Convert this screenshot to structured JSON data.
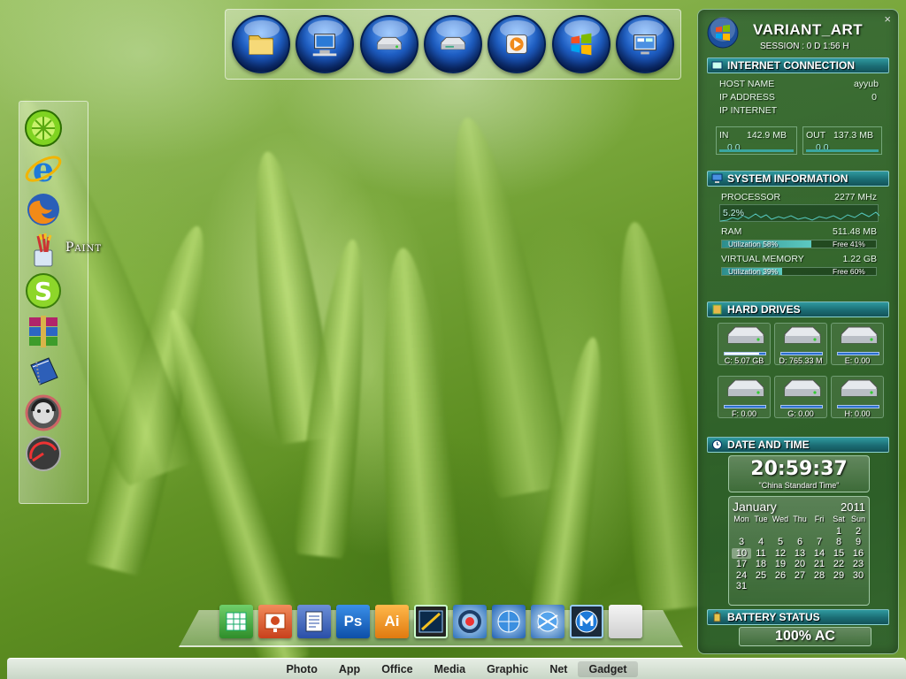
{
  "desktop": {
    "top_dock": {
      "icons": [
        "folder-icon",
        "my-computer-icon",
        "drive-icon",
        "removable-drive-icon",
        "media-player-icon",
        "windows-logo-icon",
        "control-panel-icon"
      ]
    },
    "left_dock": {
      "icons": [
        "limewire-icon",
        "internet-explorer-icon",
        "firefox-icon",
        "paint-icon",
        "skype-icon",
        "winrar-icon",
        "notebook-icon",
        "napster-icon",
        "speedometer-icon"
      ],
      "paint_label": "Paint"
    },
    "bottom_dock": {
      "icons": [
        "excel-icon",
        "powerpoint-icon",
        "word-icon",
        "photoshop-icon",
        "illustrator-icon",
        "graph-window-icon",
        "steam-icon",
        "settings-globe-icon",
        "network-globe-icon",
        "maxthon-icon",
        "blank-doc-icon"
      ],
      "labels": {
        "photoshop": "Ps",
        "illustrator": "Ai"
      }
    }
  },
  "panel": {
    "title": "VARIANT_ART",
    "session": "SESSION : 0 D 1:56 H",
    "close_glyph": "×",
    "internet": {
      "header": "INTERNET CONNECTION",
      "host_label": "HOST NAME",
      "host_value": "ayyub",
      "ip_label": "IP ADDRESS",
      "ip_value": "0",
      "ipi_label": "IP INTERNET",
      "in_label": "IN",
      "in_value": "142.9 MB",
      "in_rate": "0.0",
      "out_label": "OUT",
      "out_value": "137.3 MB",
      "out_rate": "0.0"
    },
    "system": {
      "header": "SYSTEM INFORMATION",
      "processor_label": "PROCESSOR",
      "processor_value": "2277 MHz",
      "cpu_load": "5.2%",
      "ram_label": "RAM",
      "ram_value": "511.48 MB",
      "ram_util": "Utilization 58%",
      "ram_free": "Free 41%",
      "ram_fraction": 0.58,
      "vm_label": "VIRTUAL MEMORY",
      "vm_value": "1.22 GB",
      "vm_util": "Utilization 39%",
      "vm_free": "Free 60%",
      "vm_fraction": 0.39
    },
    "drives": {
      "header": "HARD DRIVES",
      "items": [
        {
          "label": "C: 5.07 GB",
          "fill": 0.85
        },
        {
          "label": "D: 765.33 M",
          "fill": 0.0
        },
        {
          "label": "E: 0.00",
          "fill": 0.0
        },
        {
          "label": "F: 0.00",
          "fill": 0.0
        },
        {
          "label": "G: 0.00",
          "fill": 0.0
        },
        {
          "label": "H: 0.00",
          "fill": 0.0
        }
      ]
    },
    "datetime": {
      "header": "DATE AND TIME",
      "time": "20:59:37",
      "zone": "\"China Standard Time\"",
      "month": "January",
      "year": "2011",
      "weekdays": [
        "Mon",
        "Tue",
        "Wed",
        "Thu",
        "Fri",
        "Sat",
        "Sun"
      ],
      "days": [
        "",
        "",
        "",
        "",
        "",
        "1",
        "2",
        "3",
        "4",
        "5",
        "6",
        "7",
        "8",
        "9",
        "10",
        "11",
        "12",
        "13",
        "14",
        "15",
        "16",
        "17",
        "18",
        "19",
        "20",
        "21",
        "22",
        "23",
        "24",
        "25",
        "26",
        "27",
        "28",
        "29",
        "30",
        "31"
      ],
      "today": "10"
    },
    "battery": {
      "header": "BATTERY STATUS",
      "value": "100% AC"
    }
  },
  "tabs": {
    "items": [
      "Photo",
      "App",
      "Office",
      "Media",
      "Graphic",
      "Net",
      "Gadget"
    ],
    "active": "Gadget"
  },
  "colors": {
    "header_teal": "#1b6d74",
    "panel_green": "#285a32",
    "orb_blue": "#1f5fc4"
  }
}
